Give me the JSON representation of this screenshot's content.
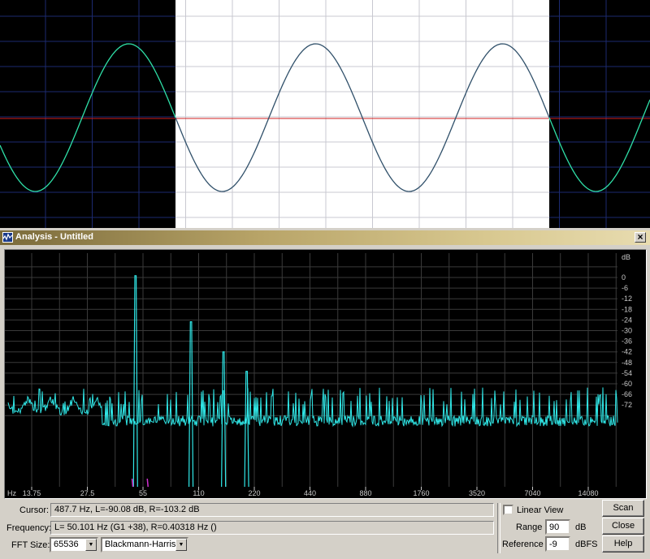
{
  "waveform": {
    "colors": {
      "background": "#000000",
      "selection": "#ffffff",
      "wave_unselected": "#2fe0a8",
      "wave_selected": "#30506a",
      "center_line": "#d02020",
      "grid": "#1c2a70"
    }
  },
  "window": {
    "title": "Analysis - Untitled",
    "close_glyph": "×"
  },
  "chart_data": {
    "type": "line",
    "x_scale": "log",
    "x_tick_unit": "Hz",
    "x_ticks": [
      "13.75",
      "27.5",
      "55",
      "110",
      "220",
      "440",
      "880",
      "1760",
      "3520",
      "7040",
      "14080"
    ],
    "y_unit": "dB",
    "y_ticks": [
      "0",
      "-6",
      "-12",
      "-18",
      "-24",
      "-30",
      "-36",
      "-42",
      "-48",
      "-54",
      "-60",
      "-66",
      "-72"
    ],
    "ylim": [
      -78,
      6
    ],
    "grid": true,
    "series": [
      {
        "color": "#30e8e8",
        "peaks": [
          {
            "x": 50.1,
            "y": 1
          },
          {
            "x": 100,
            "y": -25
          },
          {
            "x": 150,
            "y": -42
          },
          {
            "x": 200,
            "y": -53
          }
        ],
        "noise_floor_db": -70
      }
    ]
  },
  "status": {
    "cursor_label": "Cursor:",
    "cursor_value": "487.7 Hz, L=-90.08 dB, R=-103.2 dB",
    "frequency_label": "Frequency:",
    "frequency_value": "L= 50.101 Hz (G1 +38), R=0.40318 Hz ()",
    "fft_label": "FFT Size:",
    "fft_size": "65536",
    "window_function": "Blackmann-Harris"
  },
  "options": {
    "linear_view_label": "Linear View",
    "linear_view_checked": false,
    "range_label": "Range",
    "range_value": "90",
    "range_unit": "dB",
    "reference_label": "Reference",
    "reference_value": "-9",
    "reference_unit": "dBFS"
  },
  "buttons": {
    "scan": "Scan",
    "close": "Close",
    "help": "Help"
  }
}
